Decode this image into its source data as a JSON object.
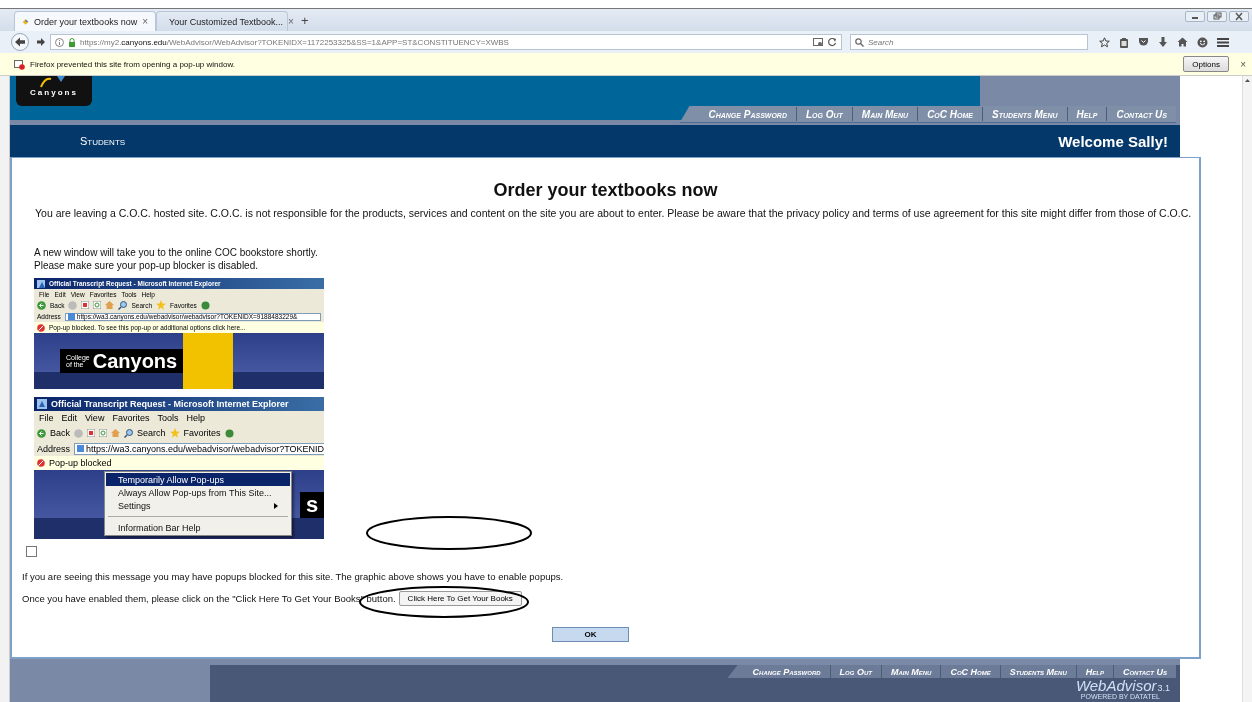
{
  "browser": {
    "tabs": [
      {
        "title": "Order your textbooks now",
        "selected": true,
        "close": "×"
      },
      {
        "title": "Your Customized Textbook...",
        "selected": false,
        "close": "×"
      }
    ],
    "new_tab": "+",
    "url": {
      "prefix": "https://my2.",
      "domain": "canyons.edu",
      "path": "/WebAdvisor/WebAdvisor?TOKENIDX=1172253325&SS=1&APP=ST&CONSTITUENCY=XWBS"
    },
    "search": {
      "placeholder": "Search"
    },
    "notification": {
      "text": "Firefox prevented this site from opening a pop-up window.",
      "button": "Options",
      "close": "×"
    }
  },
  "site": {
    "logo_text": "Canyons",
    "nav": [
      "Change Password",
      "Log Out",
      "Main Menu",
      "CoC Home",
      "Students Menu",
      "Help",
      "Contact Us"
    ],
    "section": "Students",
    "welcome": "Welcome Sally!"
  },
  "content": {
    "title": "Order your textbooks now",
    "disclaimer": "You are leaving a C.O.C. hosted site. C.O.C. is not responsible for the products, services and content on the site you are about to enter. Please be aware that the privacy policy and terms of use agreement for this site might differ from those of C.O.C.",
    "intro": [
      "A new window will take you to the online COC bookstore shortly.",
      "Please make sure your pop-up blocker is disabled."
    ],
    "example_screenshots": [
      {
        "title": "Official Transcript Request - Microsoft Internet Explorer",
        "menu": [
          "File",
          "Edit",
          "View",
          "Favorites",
          "Tools",
          "Help"
        ],
        "toolbar": [
          "Back",
          "Search",
          "Favorites"
        ],
        "address_label": "Address",
        "address": "https://wa3.canyons.edu/webadvisor/webadvisor?TOKENIDX=9188483229&",
        "info_bar": "Pop-up blocked. To see this pop-up or additional options click here...",
        "banner": [
          "College",
          "of the",
          "Canyons"
        ]
      },
      {
        "title": "Official Transcript Request - Microsoft Internet Explorer",
        "menu": [
          "File",
          "Edit",
          "View",
          "Favorites",
          "Tools",
          "Help"
        ],
        "toolbar": [
          "Back",
          "Search",
          "Favorites"
        ],
        "address_label": "Address",
        "address": "https://wa3.canyons.edu/webadvisor/webadvisor?TOKENID",
        "info_bar": "Pop-up blocked",
        "banner": [
          "s"
        ],
        "context_menu": [
          {
            "label": "Temporarily Allow Pop-ups",
            "selected": true,
            "submenu": false
          },
          {
            "label": "Always Allow Pop-ups from This Site...",
            "selected": false,
            "submenu": false
          },
          {
            "label": "Settings",
            "selected": false,
            "submenu": true
          },
          {
            "label": "Information Bar Help",
            "selected": false,
            "submenu": false
          }
        ]
      }
    ],
    "checkbox": {
      "checked": false
    },
    "message": "If you are seeing this message you may have popups blocked for this site. The graphic above shows you have to enable popups.",
    "instruction": "Once you have enabled them, please click on the \"Click Here To Get Your Books\" button.",
    "books_button": "Click Here To Get Your Books",
    "ok_button": "OK"
  },
  "footer": {
    "nav": [
      "Change Password",
      "Log Out",
      "Main Menu",
      "CoC Home",
      "Students Menu",
      "Help",
      "Contact Us"
    ],
    "brand": "WebAdvisor",
    "version": "3.1",
    "powered_by": "POWERED BY DATATEL"
  }
}
